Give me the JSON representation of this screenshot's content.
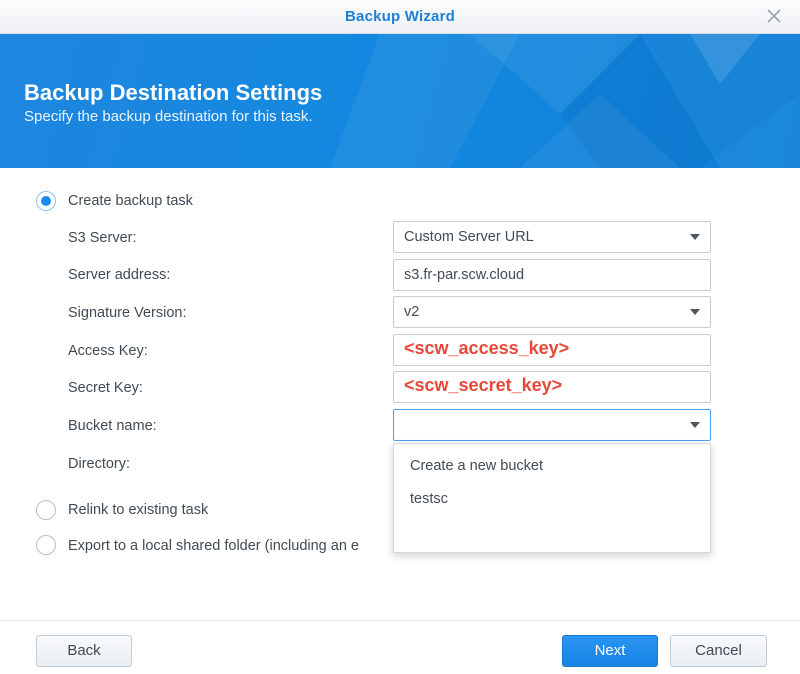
{
  "window": {
    "title": "Backup Wizard"
  },
  "banner": {
    "title": "Backup Destination Settings",
    "subtitle": "Specify the backup destination for this task."
  },
  "options": {
    "create": {
      "label": "Create backup task",
      "selected": true
    },
    "relink": {
      "label": "Relink to existing task",
      "selected": false
    },
    "export": {
      "label": "Export to a local shared folder (including an e",
      "selected": false
    }
  },
  "form": {
    "s3_server": {
      "label": "S3 Server:",
      "value": "Custom Server URL"
    },
    "server_address": {
      "label": "Server address:",
      "value": "s3.fr-par.scw.cloud"
    },
    "signature_version": {
      "label": "Signature Version:",
      "value": "v2"
    },
    "access_key": {
      "label": "Access Key:",
      "value": "<scw_access_key>"
    },
    "secret_key": {
      "label": "Secret Key:",
      "value": "<scw_secret_key>"
    },
    "bucket_name": {
      "label": "Bucket name:",
      "value": ""
    },
    "directory": {
      "label": "Directory:"
    }
  },
  "bucket_dropdown": {
    "options": [
      "Create a new bucket",
      "testsc"
    ]
  },
  "buttons": {
    "back": "Back",
    "next": "Next",
    "cancel": "Cancel"
  },
  "colors": {
    "accent": "#1a8cf0",
    "banner": "#1488e0",
    "key_highlight": "#e8473a"
  }
}
